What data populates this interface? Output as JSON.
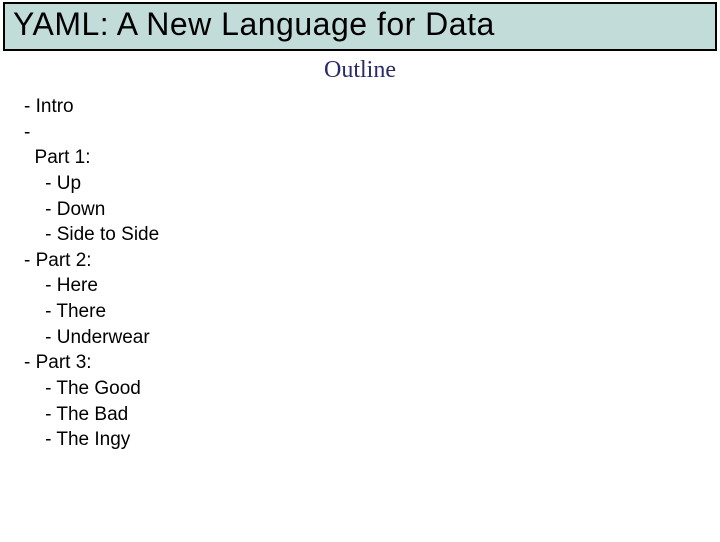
{
  "title": "YAML: A New Language for Data",
  "subtitle": "Outline",
  "outline_text": "- Intro\n-\n  Part 1:\n    - Up\n    - Down\n    - Side to Side\n- Part 2:\n    - Here\n    - There\n    - Underwear\n- Part 3:\n    - The Good\n    - The Bad\n    - The Ingy"
}
